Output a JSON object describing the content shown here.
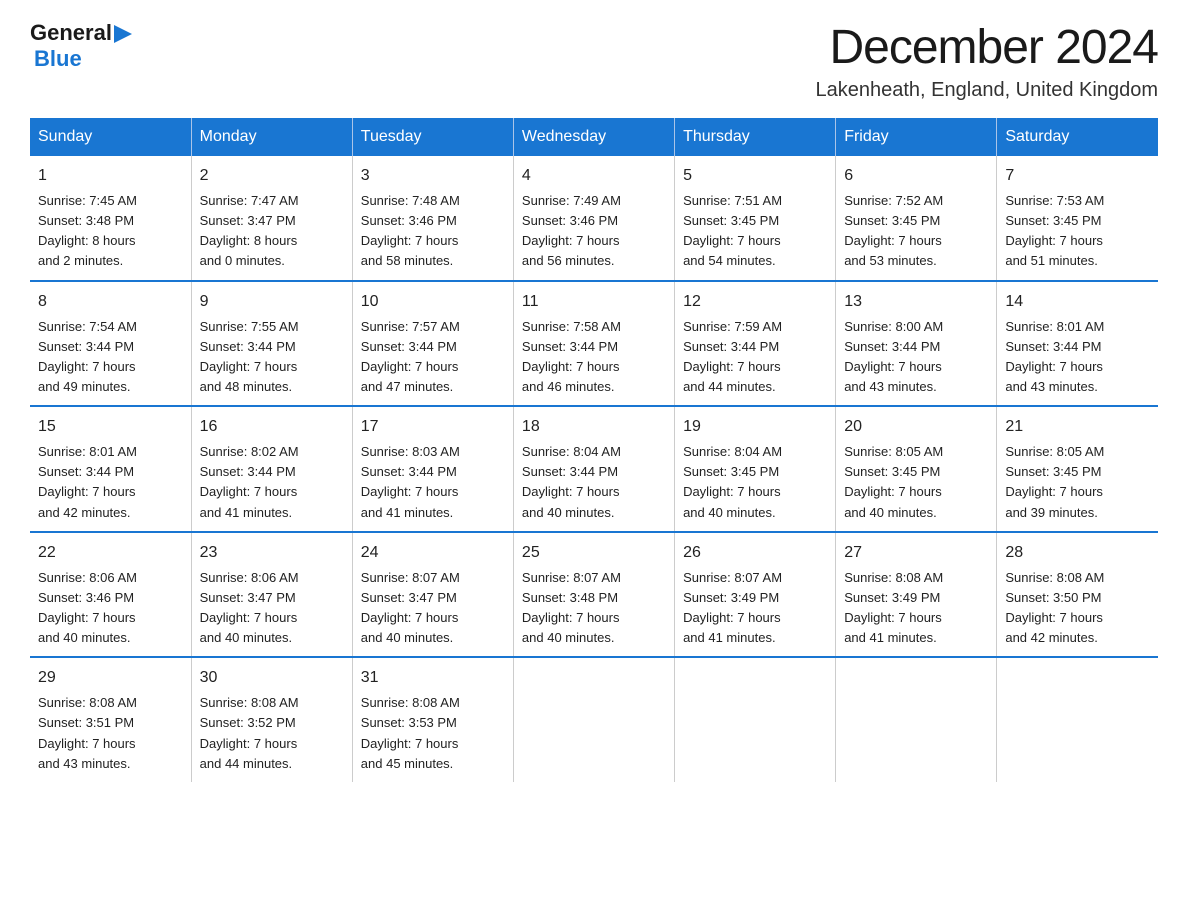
{
  "logo": {
    "general": "General",
    "arrow": "▶",
    "blue": "Blue"
  },
  "title": "December 2024",
  "subtitle": "Lakenheath, England, United Kingdom",
  "days_of_week": [
    "Sunday",
    "Monday",
    "Tuesday",
    "Wednesday",
    "Thursday",
    "Friday",
    "Saturday"
  ],
  "weeks": [
    [
      {
        "day": "1",
        "sunrise": "7:45 AM",
        "sunset": "3:48 PM",
        "daylight": "8 hours and 2 minutes."
      },
      {
        "day": "2",
        "sunrise": "7:47 AM",
        "sunset": "3:47 PM",
        "daylight": "8 hours and 0 minutes."
      },
      {
        "day": "3",
        "sunrise": "7:48 AM",
        "sunset": "3:46 PM",
        "daylight": "7 hours and 58 minutes."
      },
      {
        "day": "4",
        "sunrise": "7:49 AM",
        "sunset": "3:46 PM",
        "daylight": "7 hours and 56 minutes."
      },
      {
        "day": "5",
        "sunrise": "7:51 AM",
        "sunset": "3:45 PM",
        "daylight": "7 hours and 54 minutes."
      },
      {
        "day": "6",
        "sunrise": "7:52 AM",
        "sunset": "3:45 PM",
        "daylight": "7 hours and 53 minutes."
      },
      {
        "day": "7",
        "sunrise": "7:53 AM",
        "sunset": "3:45 PM",
        "daylight": "7 hours and 51 minutes."
      }
    ],
    [
      {
        "day": "8",
        "sunrise": "7:54 AM",
        "sunset": "3:44 PM",
        "daylight": "7 hours and 49 minutes."
      },
      {
        "day": "9",
        "sunrise": "7:55 AM",
        "sunset": "3:44 PM",
        "daylight": "7 hours and 48 minutes."
      },
      {
        "day": "10",
        "sunrise": "7:57 AM",
        "sunset": "3:44 PM",
        "daylight": "7 hours and 47 minutes."
      },
      {
        "day": "11",
        "sunrise": "7:58 AM",
        "sunset": "3:44 PM",
        "daylight": "7 hours and 46 minutes."
      },
      {
        "day": "12",
        "sunrise": "7:59 AM",
        "sunset": "3:44 PM",
        "daylight": "7 hours and 44 minutes."
      },
      {
        "day": "13",
        "sunrise": "8:00 AM",
        "sunset": "3:44 PM",
        "daylight": "7 hours and 43 minutes."
      },
      {
        "day": "14",
        "sunrise": "8:01 AM",
        "sunset": "3:44 PM",
        "daylight": "7 hours and 43 minutes."
      }
    ],
    [
      {
        "day": "15",
        "sunrise": "8:01 AM",
        "sunset": "3:44 PM",
        "daylight": "7 hours and 42 minutes."
      },
      {
        "day": "16",
        "sunrise": "8:02 AM",
        "sunset": "3:44 PM",
        "daylight": "7 hours and 41 minutes."
      },
      {
        "day": "17",
        "sunrise": "8:03 AM",
        "sunset": "3:44 PM",
        "daylight": "7 hours and 41 minutes."
      },
      {
        "day": "18",
        "sunrise": "8:04 AM",
        "sunset": "3:44 PM",
        "daylight": "7 hours and 40 minutes."
      },
      {
        "day": "19",
        "sunrise": "8:04 AM",
        "sunset": "3:45 PM",
        "daylight": "7 hours and 40 minutes."
      },
      {
        "day": "20",
        "sunrise": "8:05 AM",
        "sunset": "3:45 PM",
        "daylight": "7 hours and 40 minutes."
      },
      {
        "day": "21",
        "sunrise": "8:05 AM",
        "sunset": "3:45 PM",
        "daylight": "7 hours and 39 minutes."
      }
    ],
    [
      {
        "day": "22",
        "sunrise": "8:06 AM",
        "sunset": "3:46 PM",
        "daylight": "7 hours and 40 minutes."
      },
      {
        "day": "23",
        "sunrise": "8:06 AM",
        "sunset": "3:47 PM",
        "daylight": "7 hours and 40 minutes."
      },
      {
        "day": "24",
        "sunrise": "8:07 AM",
        "sunset": "3:47 PM",
        "daylight": "7 hours and 40 minutes."
      },
      {
        "day": "25",
        "sunrise": "8:07 AM",
        "sunset": "3:48 PM",
        "daylight": "7 hours and 40 minutes."
      },
      {
        "day": "26",
        "sunrise": "8:07 AM",
        "sunset": "3:49 PM",
        "daylight": "7 hours and 41 minutes."
      },
      {
        "day": "27",
        "sunrise": "8:08 AM",
        "sunset": "3:49 PM",
        "daylight": "7 hours and 41 minutes."
      },
      {
        "day": "28",
        "sunrise": "8:08 AM",
        "sunset": "3:50 PM",
        "daylight": "7 hours and 42 minutes."
      }
    ],
    [
      {
        "day": "29",
        "sunrise": "8:08 AM",
        "sunset": "3:51 PM",
        "daylight": "7 hours and 43 minutes."
      },
      {
        "day": "30",
        "sunrise": "8:08 AM",
        "sunset": "3:52 PM",
        "daylight": "7 hours and 44 minutes."
      },
      {
        "day": "31",
        "sunrise": "8:08 AM",
        "sunset": "3:53 PM",
        "daylight": "7 hours and 45 minutes."
      },
      null,
      null,
      null,
      null
    ]
  ],
  "labels": {
    "sunrise": "Sunrise:",
    "sunset": "Sunset:",
    "daylight": "Daylight:"
  }
}
